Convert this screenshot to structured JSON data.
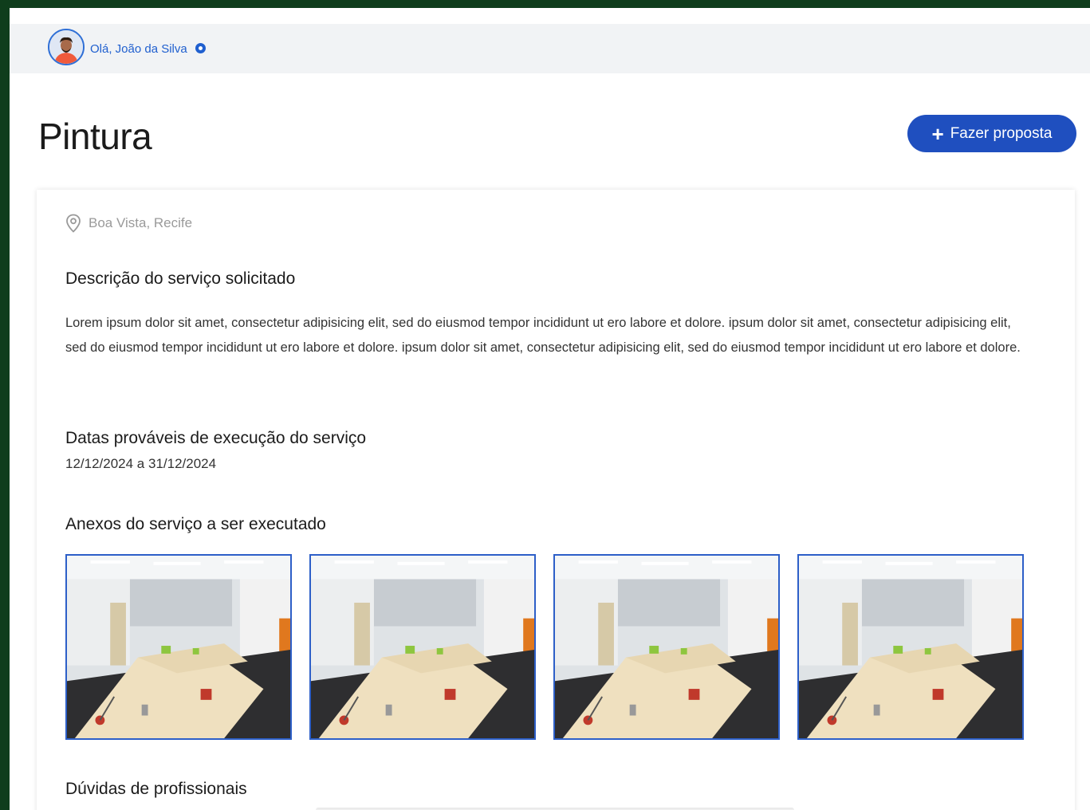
{
  "header": {
    "greeting": "Olá, João da Silva",
    "accent_color": "#1f5fcf",
    "verified_icon": "verified-badge-icon"
  },
  "page": {
    "title": "Pintura",
    "proposal_button": "Fazer proposta",
    "proposal_icon": "plus-icon"
  },
  "details": {
    "location": "Boa Vista, Recife",
    "location_icon": "map-pin-icon",
    "description_heading": "Descrição do serviço solicitado",
    "description": "Lorem ipsum dolor sit amet, consectetur adipisicing elit, sed do eiusmod tempor incididunt ut ero labore et dolore.  ipsum dolor sit amet, consectetur adipisicing elit, sed do eiusmod tempor incididunt ut ero labore et dolore. ipsum dolor sit amet, consectetur adipisicing elit, sed do eiusmod tempor incididunt ut ero labore et dolore.",
    "dates_heading": "Datas prováveis de execução do serviço",
    "dates": "12/12/2024 a 31/12/2024",
    "attachments_heading": "Anexos do serviço a ser executado",
    "attachments_count": 4,
    "questions_heading": "Dúvidas de profissionais"
  }
}
